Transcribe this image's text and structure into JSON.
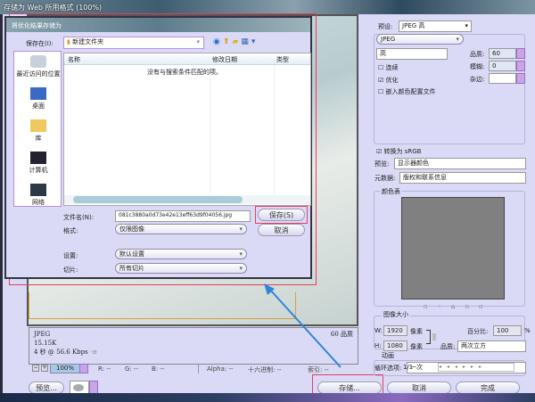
{
  "window": {
    "title": "存储为 Web 所用格式 (100%)"
  },
  "preview": {
    "format": "JPEG",
    "size": "15.15K",
    "time": "4 秒 @ 56.6 Kbps",
    "time_menu": "-≡",
    "quality": "60 品质"
  },
  "statusbar": {
    "zoom": "100%",
    "r": "R: --",
    "g": "G: --",
    "b": "B: --",
    "alpha": "Alpha: --",
    "hex": "十六进制: --",
    "index": "索引: --"
  },
  "buttons": {
    "preview": "预览...",
    "save": "存储...",
    "cancel": "取消",
    "done": "完成"
  },
  "panel": {
    "preset_label": "预设:",
    "preset_value": "JPEG 高",
    "format": "JPEG",
    "quality_level": "高",
    "quality_label": "品质:",
    "quality_value": "60",
    "blur_label": "模糊:",
    "blur_value": "0",
    "matte_label": "杂边:",
    "progressive": "连续",
    "optimized": "优化",
    "embed_profile": "嵌入颜色配置文件",
    "convert_srgb": "转换为 sRGB",
    "preview_label": "预览:",
    "preview_value": "显示器颜色",
    "metadata_label": "元数据:",
    "metadata_value": "版权和联系信息",
    "color_table": "颜色表",
    "image_size": "图像大小",
    "w_label": "W:",
    "w_value": "1920",
    "h_label": "H:",
    "h_value": "1080",
    "px": "像素",
    "percent_label": "百分比:",
    "percent_value": "100",
    "percent_unit": "%",
    "resample_label": "品质:",
    "resample_value": "两次立方",
    "animation": "动画",
    "loop_label": "循环选项:",
    "loop_value": "一次",
    "frame": "1/1"
  },
  "dialog": {
    "title": "将优化结果存储为",
    "save_in_label": "保存在(I):",
    "save_in_value": "新建文件夹",
    "sidebar": [
      "最近访问的位置",
      "桌面",
      "库",
      "计算机",
      "网络"
    ],
    "columns": [
      "名称",
      "修改日期",
      "类型"
    ],
    "empty": "没有与搜索条件匹配的项。",
    "filename_label": "文件名(N):",
    "filename_value": "081c3880a0d73e42e13eff63d9f04056.jpg",
    "format_label": "格式:",
    "format_value": "仅限图像",
    "settings_label": "设置:",
    "settings_value": "默认设置",
    "slices_label": "切片:",
    "slices_value": "所有切片",
    "save": "保存(S)",
    "cancel": "取消"
  }
}
